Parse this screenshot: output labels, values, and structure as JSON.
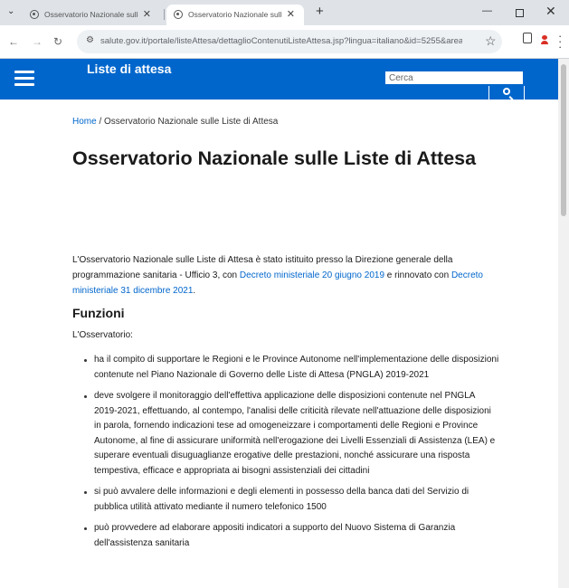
{
  "browser": {
    "tabs": [
      {
        "title": "Osservatorio Nazionale sulle Lis",
        "active": false
      },
      {
        "title": "Osservatorio Nazionale sulle Lis",
        "active": true
      }
    ],
    "url": "salute.gov.it/portale/listeAttesa/dettaglioContenutiListeAttesa.jsp?lingua=italiano&id=5255&area..."
  },
  "header": {
    "site_title": "Liste di attesa",
    "search_placeholder": "Cerca"
  },
  "breadcrumb": {
    "home": "Home",
    "separator": " / ",
    "current": "Osservatorio Nazionale sulle Liste di Attesa"
  },
  "page": {
    "title": "Osservatorio Nazionale sulle Liste di Attesa",
    "intro_before": "L'Osservatorio Nazionale sulle Liste di Attesa è stato istituito presso la Direzione generale della programmazione sanitaria - Ufficio 3, con ",
    "intro_link1": "Decreto ministeriale 20 giugno 2019",
    "intro_middle": " e rinnovato con ",
    "intro_link2": "Decreto ministeriale 31 dicembre 2021",
    "intro_after": ".",
    "section_title": "Funzioni",
    "lead": "L'Osservatorio:",
    "bullets": [
      "ha il compito di supportare le Regioni e le Province Autonome nell'implementazione delle disposizioni contenute nel Piano Nazionale di Governo delle Liste di Attesa (PNGLA) 2019-2021",
      "deve svolgere il monitoraggio dell'effettiva applicazione delle disposizioni contenute nel PNGLA 2019-2021, effettuando, al contempo, l'analisi delle criticità rilevate nell'attuazione delle disposizioni in parola, fornendo indicazioni tese ad omogeneizzare i comportamenti delle Regioni e Province Autonome, al fine di assicurare uniformità nell'erogazione dei Livelli Essenziali di Assistenza (LEA) e superare eventuali disuguaglianze erogative delle prestazioni, nonché assicurare una risposta tempestiva, efficace e appropriata ai bisogni assistenziali dei cittadini",
      "si può avvalere delle informazioni e degli elementi in possesso della banca dati del Servizio di pubblica utilità attivato mediante il numero telefonico 1500",
      "può provvedere ad elaborare appositi indicatori a supporto del Nuovo Sistema di Garanzia dell'assistenza sanitaria"
    ]
  },
  "colors": {
    "brand_blue": "#0066cc"
  }
}
